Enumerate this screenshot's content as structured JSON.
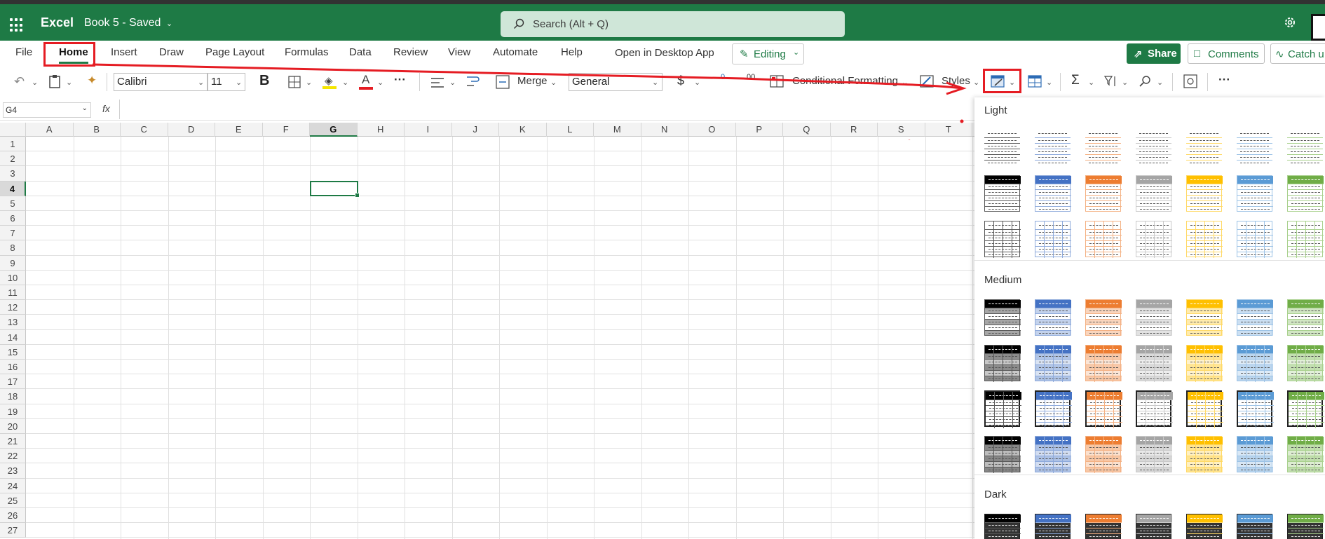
{
  "app": {
    "name": "Excel",
    "document_title": "Book 5 - Saved",
    "chevron": "chevron-down-icon"
  },
  "search": {
    "placeholder": "Search (Alt + Q)",
    "icon": "search-icon"
  },
  "menu_tabs": [
    "File",
    "Home",
    "Insert",
    "Draw",
    "Page Layout",
    "Formulas",
    "Data",
    "Review",
    "View",
    "Automate",
    "Help",
    "Open in Desktop App"
  ],
  "active_tab": "Home",
  "editing": {
    "label": "Editing",
    "icon": "pencil-icon"
  },
  "share": {
    "label": "Share",
    "icon": "share-icon"
  },
  "comments": {
    "label": "Comments",
    "icon": "comment-icon"
  },
  "catchup": {
    "label": "Catch u",
    "icon": "pulse-icon"
  },
  "ribbon": {
    "font_name": "Calibri",
    "font_size": "11",
    "bold": "B",
    "font_color_glyph": "A",
    "more": "···",
    "merge": "Merge",
    "number_format": "General",
    "currency": "$",
    "increase_decimal": ".00",
    "decrease_decimal": "←0",
    "conditional_formatting": "Conditional Formatting",
    "styles": "Styles",
    "more2": "···",
    "icons": [
      "undo-icon",
      "paste-icon",
      "format-painter-icon",
      "borders-icon",
      "fill-color-icon",
      "font-color-icon",
      "align-icon",
      "wrap-text-icon",
      "merge-icon",
      "currency-icon",
      "conditional-formatting-icon",
      "cell-styles-icon",
      "format-as-table-icon",
      "table-icon",
      "autosum-icon",
      "sort-filter-icon",
      "find-icon",
      "add-ins-icon"
    ]
  },
  "formula_bar": {
    "name_box": "G4",
    "fx": "fx",
    "value": ""
  },
  "sheet": {
    "columns": [
      "A",
      "B",
      "C",
      "D",
      "E",
      "F",
      "G",
      "H",
      "I",
      "J",
      "K",
      "L",
      "M",
      "N",
      "O",
      "P",
      "Q",
      "R",
      "S",
      "T"
    ],
    "rows": [
      "1",
      "2",
      "3",
      "4",
      "5",
      "6",
      "7",
      "8",
      "9",
      "10",
      "11",
      "12",
      "13",
      "14",
      "15",
      "16",
      "17",
      "18",
      "19",
      "20",
      "21",
      "22",
      "23",
      "24",
      "25",
      "26",
      "27"
    ],
    "active_cell": "G4",
    "active_column": "G",
    "active_row": "4"
  },
  "table_styles_gallery": {
    "sections": [
      {
        "label": "Light",
        "rows": 3
      },
      {
        "label": "Medium",
        "rows": 4
      },
      {
        "label": "Dark",
        "rows": 1
      }
    ],
    "colors": [
      "#000000",
      "#4472c4",
      "#ed7d31",
      "#a5a5a5",
      "#ffc000",
      "#5b9bd5",
      "#70ad47"
    ],
    "light_colors": [
      "#595959",
      "#8eaadb",
      "#f4b183",
      "#c9c9c9",
      "#ffd966",
      "#9dc3e6",
      "#a9d18e"
    ]
  },
  "annotation": {
    "color": "#e51c23"
  }
}
